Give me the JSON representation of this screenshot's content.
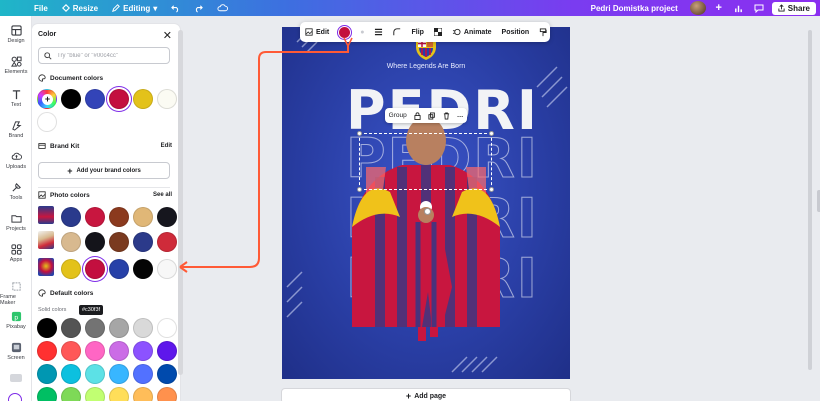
{
  "topbar": {
    "file": "File",
    "resize": "Resize",
    "editing": "Editing",
    "project_name": "Pedri Domistka project",
    "share": "Share",
    "icons": [
      "menu-icon",
      "resize-icon",
      "pencil-icon",
      "undo-icon",
      "redo-icon",
      "cloud-icon",
      "plus-icon",
      "chart-icon",
      "comment-icon",
      "upload-icon"
    ]
  },
  "rail": {
    "items": [
      {
        "label": "Design",
        "icon": "design-icon"
      },
      {
        "label": "Elements",
        "icon": "elements-icon"
      },
      {
        "label": "Text",
        "icon": "text-icon"
      },
      {
        "label": "Brand",
        "icon": "brand-icon"
      },
      {
        "label": "Uploads",
        "icon": "uploads-icon"
      },
      {
        "label": "Tools",
        "icon": "tools-icon"
      },
      {
        "label": "Projects",
        "icon": "projects-icon"
      },
      {
        "label": "Apps",
        "icon": "apps-icon"
      },
      {
        "label": "Frame Maker",
        "icon": "frame-maker-icon"
      },
      {
        "label": "Pixabay",
        "icon": "pixabay-icon"
      },
      {
        "label": "Screen",
        "icon": "screen-icon"
      }
    ]
  },
  "panel": {
    "title": "Color",
    "search_placeholder": "Try \"blue\" or \"#00c4cc\"",
    "document_colors_label": "Document colors",
    "document_colors": [
      "#000000",
      "#3344b8",
      "#c30f3f",
      "#e3c21a",
      "#fbfbf3",
      "#ffffff"
    ],
    "brand_kit_label": "Brand Kit",
    "brand_kit_edit": "Edit",
    "add_brand_colors": "Add your brand colors",
    "photo_colors_label": "Photo colors",
    "photo_colors_see_all": "See all",
    "photo_rows": [
      [
        "#2a3a8c",
        "#c8163f",
        "#8b3a1e",
        "#e0b777",
        "#16161e"
      ],
      [
        "#d8b98f",
        "#14141a",
        "#7a3a1f",
        "#2b3a8a",
        "#cf2b3a"
      ],
      [
        "#e3c21a",
        "#c30f3f",
        "#2741a8",
        "#050505",
        "#f7f7f7"
      ]
    ],
    "tooltip": "#c30f3f",
    "default_colors_label": "Default colors",
    "solid_colors_label": "Solid colors",
    "solid_rows": [
      [
        "#000000",
        "#545454",
        "#737373",
        "#a6a6a6",
        "#d9d9d9",
        "#ffffff"
      ],
      [
        "#ff3131",
        "#ff5757",
        "#ff66c4",
        "#cb6ce6",
        "#8c52ff",
        "#5e17eb"
      ],
      [
        "#0097b2",
        "#0cc0df",
        "#5ce1e6",
        "#38b6ff",
        "#5271ff",
        "#004aad"
      ],
      [
        "#00bf63",
        "#7ed957",
        "#c1ff72",
        "#ffde59",
        "#ffbd59",
        "#ff914d"
      ]
    ]
  },
  "float_toolbar": {
    "edit": "Edit",
    "flip": "Flip",
    "animate": "Animate",
    "position": "Position"
  },
  "group_bar": {
    "group": "Group"
  },
  "poster": {
    "tagline": "Where Legends Are Born",
    "name": "PEDRI"
  },
  "canvas": {
    "add_page": "Add page"
  },
  "colors": {
    "accent": "#7d2ae8",
    "annotation": "#ff5a36"
  }
}
